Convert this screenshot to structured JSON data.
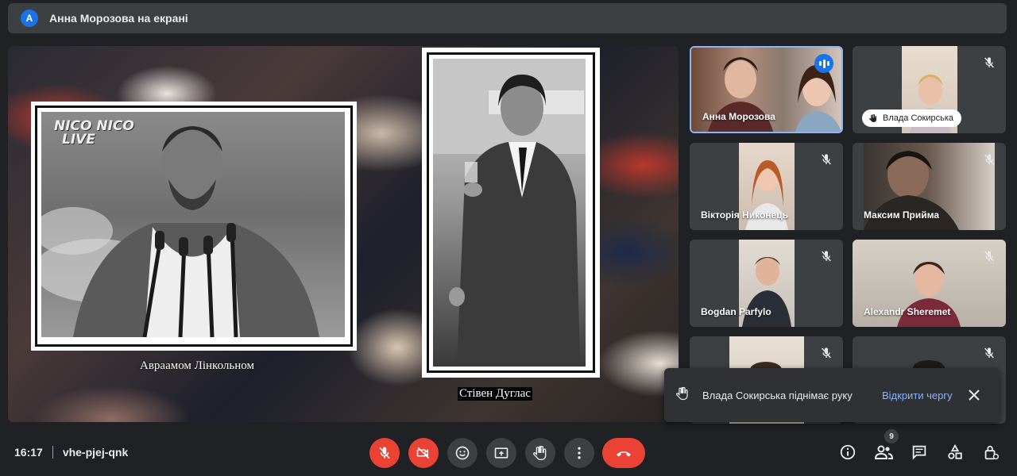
{
  "presenting": {
    "avatar_letter": "А",
    "title": "Анна Морозова на екрані"
  },
  "presentation": {
    "logo_line1": "NICO NICO",
    "logo_line2": "LIVE",
    "caption_left": "Авраамом Лінкольном",
    "caption_right": "Стівен Дуглас"
  },
  "participants": [
    {
      "name": "Анна Морозова",
      "speaking": true
    },
    {
      "name": "Влада Сокирська",
      "muted": true,
      "hand_raised": true
    },
    {
      "name": "Вікторія Никонець",
      "muted": true
    },
    {
      "name": "Максим Прийма",
      "muted": true
    },
    {
      "name": "Bogdan Parfylo",
      "muted": true
    },
    {
      "name": "Alexandr Sheremet",
      "muted": true
    },
    {
      "name": "",
      "muted": true
    },
    {
      "name": "",
      "muted": true
    }
  ],
  "toast": {
    "message": "Влада Сокирська піднімає руку",
    "action": "Відкрити чергу"
  },
  "bottom": {
    "time": "16:17",
    "meeting_code": "vhe-pjej-qnk",
    "participant_count": "9"
  },
  "colors": {
    "background": "#202124",
    "tile": "#3c4043",
    "danger": "#ea4335",
    "accent": "#1a73e8",
    "link": "#8ab4f8"
  },
  "icons": [
    "mic-off-icon",
    "camera-off-icon",
    "emoji-icon",
    "present-icon",
    "raise-hand-icon",
    "more-icon",
    "hangup-icon",
    "info-icon",
    "people-icon",
    "chat-icon",
    "activities-icon",
    "host-controls-icon",
    "close-icon",
    "speaking-icon"
  ]
}
